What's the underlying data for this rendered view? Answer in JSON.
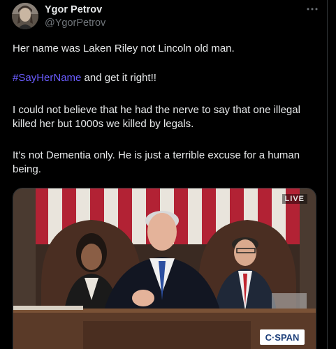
{
  "author": {
    "display_name": "Ygor Petrov",
    "handle": "@YgorPetrov",
    "avatar_icon": "user-avatar"
  },
  "more_icon": "more-horizontal-icon",
  "tweet": {
    "line1": "Her name was Laken Riley not Lincoln old man.",
    "hashtag": "#SayHerName",
    "line2_rest": " and get it right!!",
    "paragraph3": "I could not believe that he had the nerve to say that one illegal killed her but 1000s we killed by legals.",
    "paragraph4": "It's not Dementia only. He is just a terrible excuse for a human being."
  },
  "media": {
    "live_label": "LIVE",
    "logo_text": "C·SPAN"
  },
  "colors": {
    "background": "#000000",
    "text": "#e7e9ea",
    "secondary": "#71767b",
    "hashtag": "#6a5cff",
    "border": "#2f3336"
  }
}
